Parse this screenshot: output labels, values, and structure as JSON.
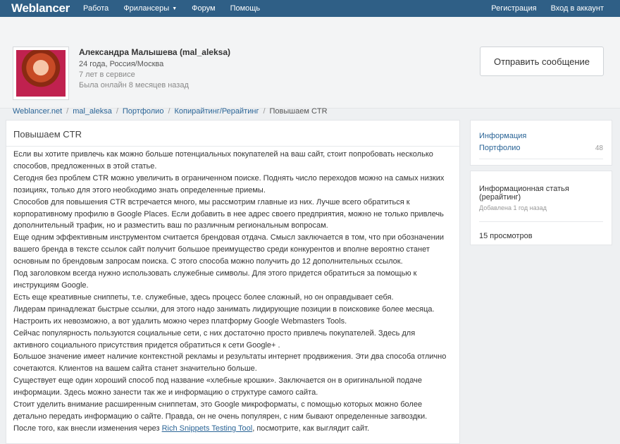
{
  "nav": {
    "logo": "Weblancer",
    "items": [
      "Работа",
      "Фрилансеры",
      "Форум",
      "Помощь"
    ],
    "register": "Регистрация",
    "login": "Вход в аккаунт"
  },
  "profile": {
    "name": "Александра Малышева (mal_aleksa)",
    "age_location": "24 года, Россия/Москва",
    "service": "7 лет в сервисе",
    "last_online": "Была онлайн 8 месяцев назад",
    "message_button": "Отправить сообщение"
  },
  "breadcrumbs": [
    "Weblancer.net",
    "mal_aleksa",
    "Портфолио",
    "Копирайтинг/Рерайтинг",
    "Повышаем CTR"
  ],
  "article": {
    "title": "Повышаем CTR",
    "paragraphs": [
      "Если вы хотите привлечь как можно больше потенциальных покупателей на ваш сайт, стоит попробовать несколько способов, предложенных в этой статье.",
      "Сегодня без проблем CTR можно увеличить в ограниченном поиске. Поднять число переходов можно на самых низких позициях, только для этого необходимо знать определенные приемы.",
      " Способов для повышения CTR встречается много, мы рассмотрим главные из них. Лучше всего обратиться к корпоративному профилю  в Google Places. Если добавить в нее адрес своего предприятия, можно не только привлечь дополнительный трафик, но и разместить ваш по различным региональным вопросам.",
      "Еще одним эффективным инструментом считается брендовая отдача. Смысл заключается в том, что при обозначении вашего бренда в тексте ссылок сайт получит большое преимущество среди конкурентов и вполне вероятно станет основным по брендовым запросам поиска. С этого способа можно получить до 12 дополнительных ссылок.",
      "Под заголовком всегда нужно использовать служебные символы. Для этого придется обратиться за помощью к инструкциям Google.",
      "Есть еще креативные сниппеты, т.е. служебные, здесь процесс более сложный, но он оправдывает себя.",
      "Лидерам принадлежат  быстрые ссылки, для этого надо занимать лидирующие позиции в поисковике более месяца. Настроить их невозможно, а вот удалить можно через платформу Google Webmasters Tools.",
      "Сейчас популярность пользуются социальные сети, с них достаточно просто привлечь покупателей. Здесь для активного социального присутствия придется обратиться к сети Google+ .",
      "Большое значение имеет наличие контекстной рекламы и результаты интернет продвижения. Эти два способа отлично сочетаются. Клиентов на вашем сайта станет значительно больше.",
      "Существует еще один хороший способ под название  «хлебные крошки». Заключается он в оригинальной подаче информации. Здесь можно занести так же и информацию о структуре самого сайта.",
      "Стоит уделить внимание расширенным сниппетам, это Google микроформаты, с помощью которых можно более детально передать информацию о сайте. Правда, он не очень популярен, с ним бывают определенные загвоздки."
    ],
    "last_before": "После того, как внесли изменения через ",
    "last_link": "Rich Snippets Testing Tool",
    "last_after": ", посмотрите, как выглядит сайт."
  },
  "sidebar": {
    "info_label": "Информация",
    "portfolio_label": "Портфолио",
    "portfolio_count": "48",
    "item_title": "Информационная статья (рерайтинг)",
    "item_added": "Добавлена 1 год назад",
    "views": "15 просмотров"
  },
  "colors": {
    "nav_bg": "#2f5f86",
    "link": "#2a6496",
    "page_bg": "#eef0f2"
  }
}
